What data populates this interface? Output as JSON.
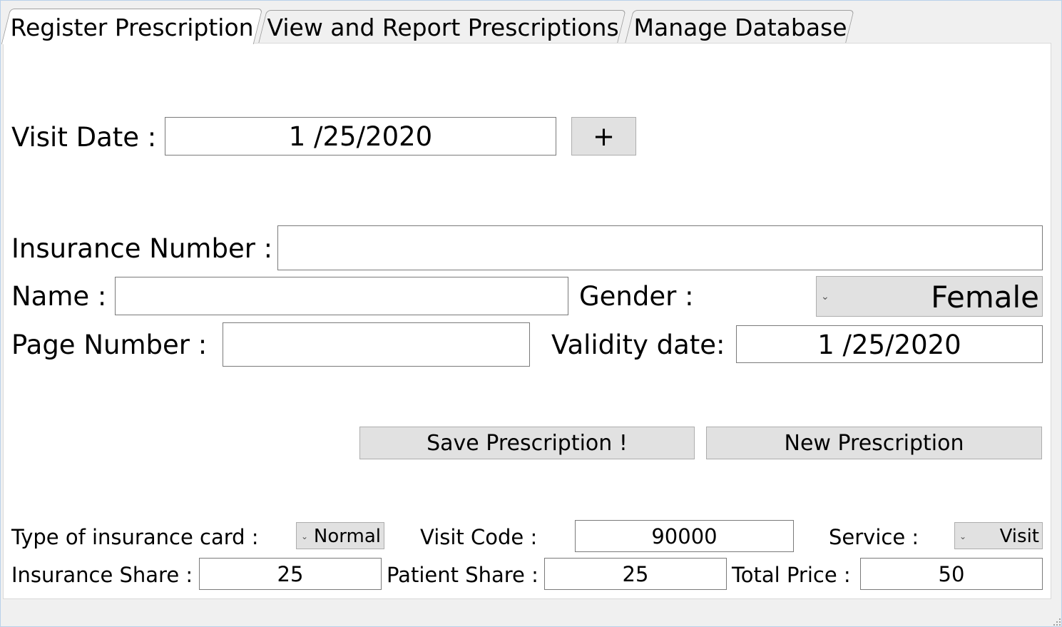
{
  "tabs": [
    {
      "label": "Register Prescription",
      "active": true
    },
    {
      "label": "View and Report Prescriptions",
      "active": false
    },
    {
      "label": "Manage Database",
      "active": false
    }
  ],
  "form": {
    "visit_date_label": "Visit Date :",
    "visit_date_value": "1 /25/2020",
    "add_button_label": "+",
    "insurance_number_label": "Insurance Number :",
    "insurance_number_value": "",
    "name_label": "Name :",
    "name_value": "",
    "gender_label": "Gender :",
    "gender_value": "Female",
    "page_number_label": "Page Number :",
    "page_number_value": "",
    "validity_date_label": "Validity date:",
    "validity_date_value": "1 /25/2020",
    "save_button_label": "Save Prescription !",
    "new_button_label": "New Prescription",
    "card_type_label": "Type of insurance card :",
    "card_type_value": "Normal",
    "visit_code_label": "Visit Code :",
    "visit_code_value": "90000",
    "service_label": "Service :",
    "service_value": "Visit",
    "insurance_share_label": "Insurance Share :",
    "insurance_share_value": "25",
    "patient_share_label": "Patient Share :",
    "patient_share_value": "25",
    "total_price_label": "Total Price :",
    "total_price_value": "50"
  },
  "icons": {
    "dropdown": "chevron-down-icon",
    "resize": "resize-grip-icon"
  },
  "colors": {
    "window_bg": "#f0f0f0",
    "panel_bg": "#ffffff",
    "button_bg": "#e1e1e1",
    "field_border": "#7a7a7a"
  }
}
